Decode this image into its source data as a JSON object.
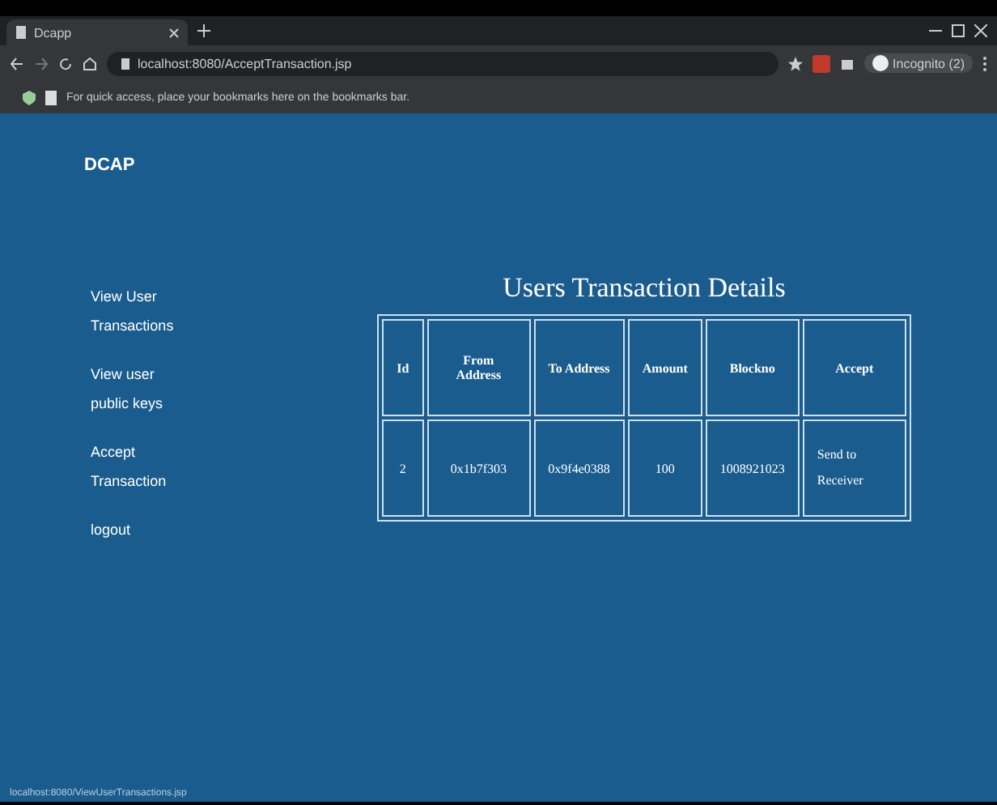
{
  "browser": {
    "tab_title": "Dcapp",
    "url": "localhost:8080/AcceptTransaction.jsp",
    "profile": "Incognito (2)",
    "bookmarks_hint": "For quick access, place your bookmarks here on the bookmarks bar.",
    "status_text": "localhost:8080/ViewUserTransactions.jsp"
  },
  "app": {
    "brand": "DCAP"
  },
  "sidebar": {
    "items": [
      {
        "label": "View User Transactions"
      },
      {
        "label": "View user public keys"
      },
      {
        "label": "Accept Transaction"
      },
      {
        "label": "logout"
      }
    ]
  },
  "page_title": "Users Transaction Details",
  "table": {
    "columns": [
      "Id",
      "From Address",
      "To Address",
      "Amount",
      "Blockno",
      "Accept"
    ],
    "rows": [
      {
        "cells": [
          "2",
          "0x1b7f303",
          "0x9f4e0388",
          "100",
          "1008921023"
        ],
        "action": "Send to Receiver"
      }
    ]
  }
}
